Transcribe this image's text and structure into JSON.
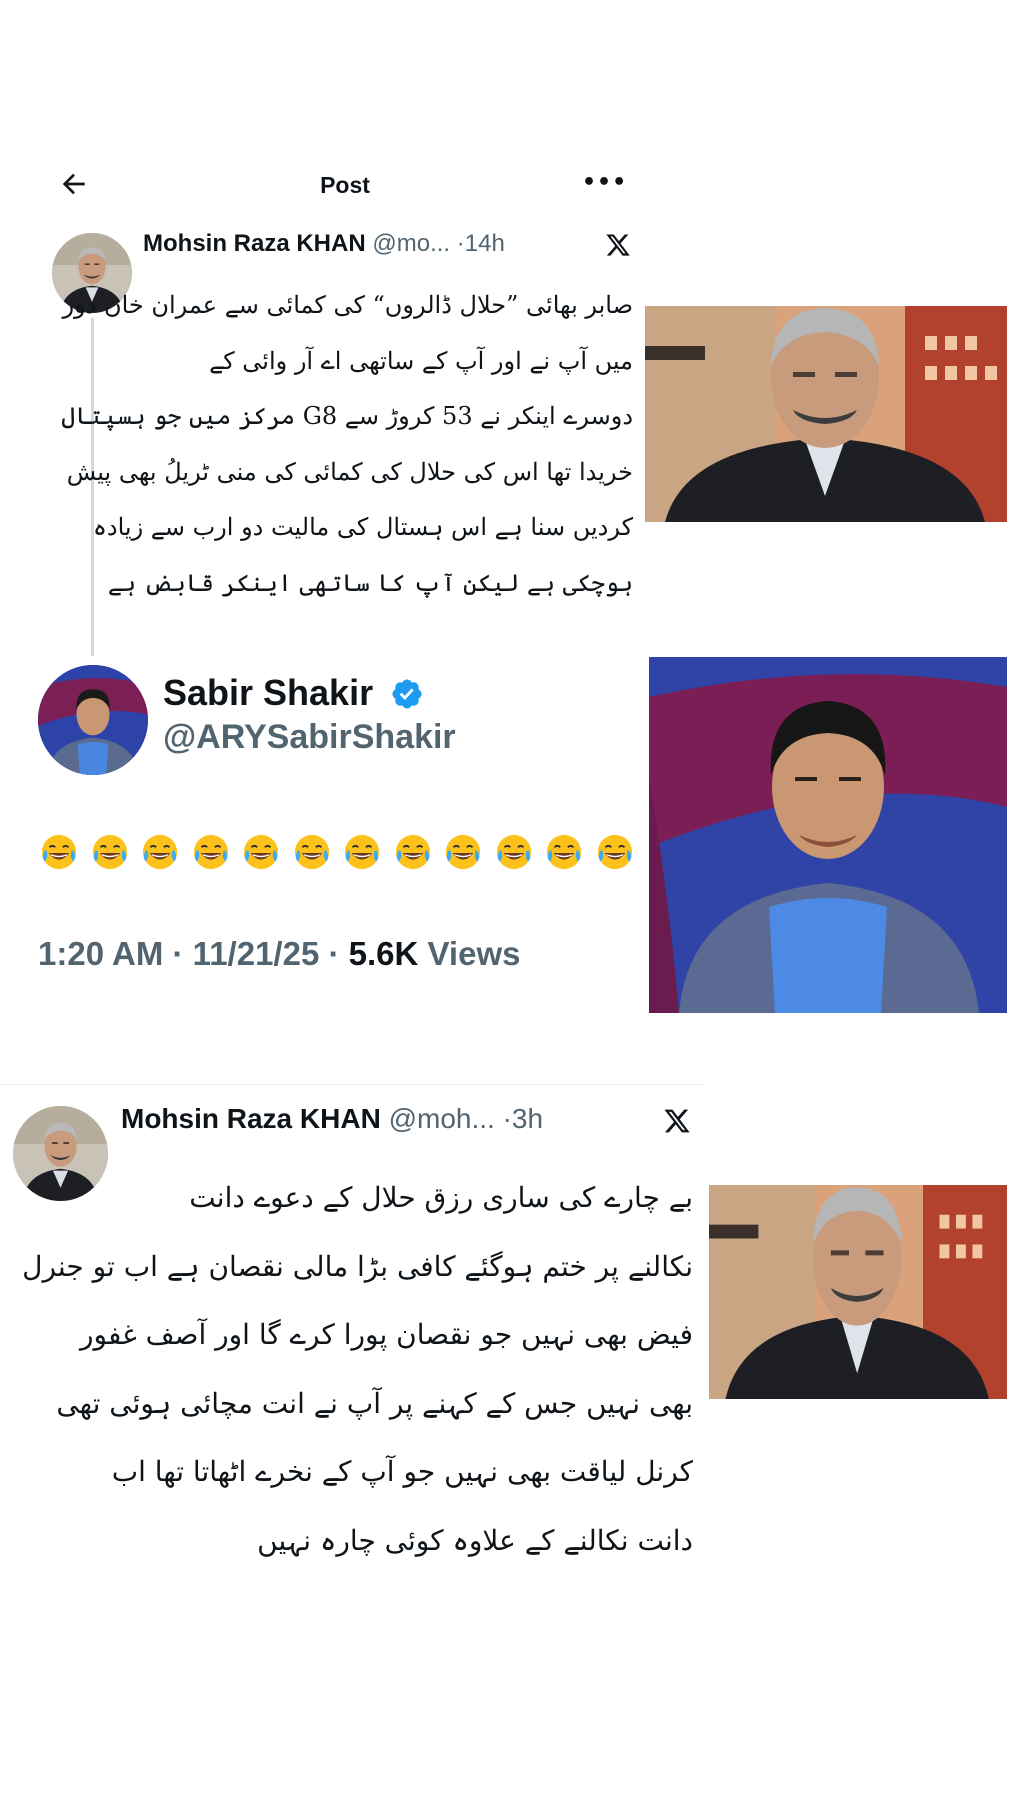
{
  "header": {
    "title": "Post",
    "back_icon": "arrow-left-icon",
    "more_label": "•••"
  },
  "colors": {
    "text": "#0f1419",
    "secondary": "#536471",
    "verified": "#1d9bf0",
    "thread_line": "#cfd9de"
  },
  "tweet1": {
    "name": "Mohsin Raza KHAN",
    "handle": "@mo...",
    "dot": "·",
    "time": "14h",
    "lines": [
      "صابر بھائی ”حلال ڈالروں“ کی کمائی سے عمران خان دور",
      "میں آپ نے اور آپ کے ساتھی اے آر وائی کے",
      "دوسرے اینکر نے 53 کروڑ سے G8 مرکز میں جو ہسپتال",
      "خریدا تھا اس کی حلال کی کمائی کی منی ٹریلُ بھی پیش",
      "کردیں سنا ہے اس ہستال کی مالیت دو ارب سے زیادہ",
      "ہوچکی ہے لیکن آپ کا ساتھی اینکر قابض ہے"
    ]
  },
  "quoted": {
    "name": "Sabir Shakir",
    "handle": "@ARYSabirShakir",
    "emoji_name": "face-with-tears-of-joy-icon",
    "emoji_count": 12,
    "time": "1:20 AM",
    "sep1": " · ",
    "date": "11/21/25",
    "sep2": " · ",
    "views_count": "5.6K",
    "views_label": " Views"
  },
  "tweet2": {
    "name": "Mohsin Raza KHAN",
    "handle": "@moh...",
    "dot": "·",
    "time": "3h",
    "lines": [
      "بے چارے کی ساری رزق حلال کے دعوے دانت",
      "نکالنے پر ختم ہوگئے کافی بڑا مالی نقصان ہے اب تو جنرل",
      "فیض بھی نہیں جو نقصان پورا کرے گا اور آصف غفور",
      "بھی نہیں جس کے کہنے پر آپ نے انت مچائی ہوئی تھی",
      "کرنل لیاقت بھی نہیں جو آپ کے نخرے اٹھاتا تھا اب",
      "دانت نکالنے کے علاوہ کوئی چارہ نہیں"
    ]
  }
}
